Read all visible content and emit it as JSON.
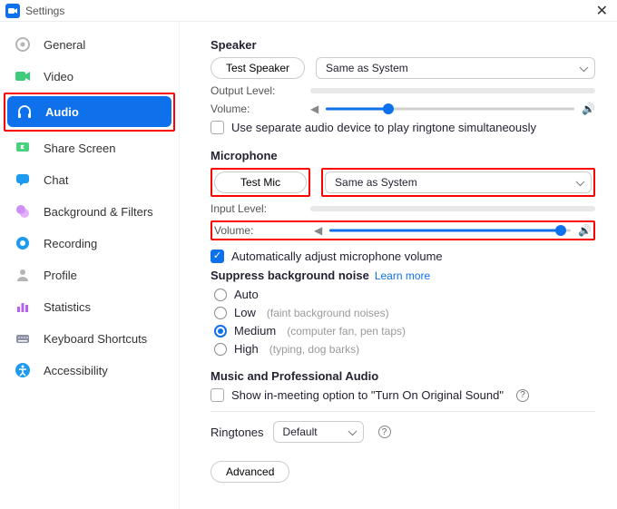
{
  "title": "Settings",
  "sidebar": {
    "items": [
      {
        "label": "General",
        "icon": "gear-icon",
        "color": "#b5b5b5"
      },
      {
        "label": "Video",
        "icon": "video-icon",
        "color": "#3ecc7b"
      },
      {
        "label": "Audio",
        "icon": "headphones-icon",
        "color": "#ffffff",
        "active": true,
        "highlight": true
      },
      {
        "label": "Share Screen",
        "icon": "share-screen-icon",
        "color": "#47d27e"
      },
      {
        "label": "Chat",
        "icon": "chat-icon",
        "color": "#1e9bf0"
      },
      {
        "label": "Background & Filters",
        "icon": "filters-icon",
        "color": "#b860f0"
      },
      {
        "label": "Recording",
        "icon": "recording-icon",
        "color": "#1e9bf0"
      },
      {
        "label": "Profile",
        "icon": "profile-icon",
        "color": "#b5b5b5"
      },
      {
        "label": "Statistics",
        "icon": "statistics-icon",
        "color": "#b860f0"
      },
      {
        "label": "Keyboard Shortcuts",
        "icon": "keyboard-icon",
        "color": "#8b8fa3"
      },
      {
        "label": "Accessibility",
        "icon": "accessibility-icon",
        "color": "#1e9bf0"
      }
    ]
  },
  "speaker": {
    "heading": "Speaker",
    "test_button": "Test Speaker",
    "device": "Same as System",
    "output_label": "Output Level:",
    "volume_label": "Volume:",
    "volume_percent": 25,
    "separate_ringtone": {
      "checked": false,
      "label": "Use separate audio device to play ringtone simultaneously"
    }
  },
  "microphone": {
    "heading": "Microphone",
    "test_button": "Test Mic",
    "device": "Same as System",
    "input_label": "Input Level:",
    "volume_label": "Volume:",
    "volume_percent": 96,
    "auto_adjust": {
      "checked": true,
      "label": "Automatically adjust microphone volume"
    }
  },
  "suppress": {
    "heading": "Suppress background noise",
    "learn_more": "Learn more",
    "options": [
      {
        "label": "Auto",
        "hint": "",
        "selected": false
      },
      {
        "label": "Low",
        "hint": "(faint background noises)",
        "selected": false
      },
      {
        "label": "Medium",
        "hint": "(computer fan, pen taps)",
        "selected": true
      },
      {
        "label": "High",
        "hint": "(typing, dog barks)",
        "selected": false
      }
    ]
  },
  "music": {
    "heading": "Music and Professional Audio",
    "original_sound": {
      "checked": false,
      "label": "Show in-meeting option to \"Turn On Original Sound\""
    }
  },
  "ringtones": {
    "label": "Ringtones",
    "value": "Default"
  },
  "advanced_button": "Advanced"
}
